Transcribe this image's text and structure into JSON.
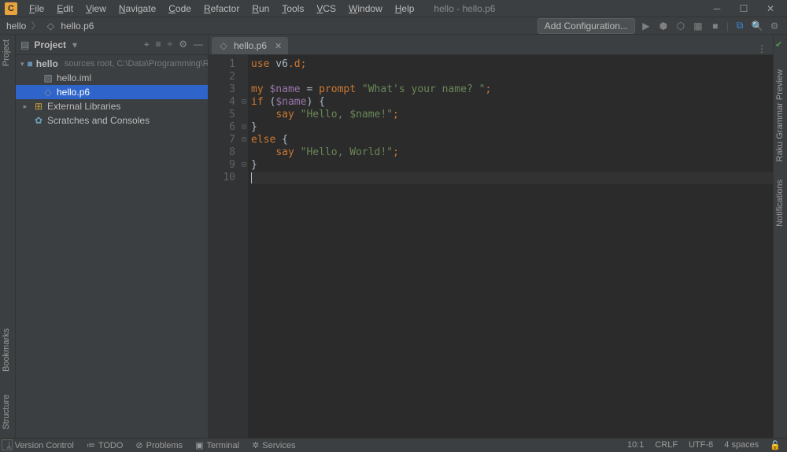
{
  "window": {
    "title": "hello - hello.p6"
  },
  "menu": [
    "File",
    "Edit",
    "View",
    "Navigate",
    "Code",
    "Refactor",
    "Run",
    "Tools",
    "VCS",
    "Window",
    "Help"
  ],
  "breadcrumbs": [
    "hello",
    "hello.p6"
  ],
  "toolbar": {
    "add_config": "Add Configuration..."
  },
  "left_tabs": {
    "project": "Project",
    "bookmarks": "Bookmarks",
    "structure": "Structure"
  },
  "sidebar": {
    "title": "Project",
    "root": {
      "name": "hello",
      "hint": "sources root,  C:\\Data\\Programming\\Raku\\hello"
    },
    "children": [
      {
        "name": "hello.iml",
        "type": "file"
      },
      {
        "name": "hello.p6",
        "type": "file",
        "selected": true
      }
    ],
    "ext_libs": "External Libraries",
    "scratches": "Scratches and Consoles"
  },
  "tabs": [
    {
      "label": "hello.p6"
    }
  ],
  "code": {
    "lines": [
      {
        "n": 1,
        "seg": [
          [
            "kw",
            "use"
          ],
          [
            "",
            " v6"
          ],
          [
            "pun",
            ".d"
          ],
          [
            "pun",
            ";"
          ]
        ]
      },
      {
        "n": 2,
        "seg": []
      },
      {
        "n": 3,
        "seg": [
          [
            "kw",
            "my"
          ],
          [
            "",
            " "
          ],
          [
            "var",
            "$name"
          ],
          [
            "",
            " = "
          ],
          [
            "kw",
            "prompt"
          ],
          [
            "",
            " "
          ],
          [
            "str",
            "\"What's your name? \""
          ],
          [
            "pun",
            ";"
          ]
        ]
      },
      {
        "n": 4,
        "fold": "-",
        "seg": [
          [
            "kw",
            "if"
          ],
          [
            "",
            " ("
          ],
          [
            "var",
            "$name"
          ],
          [
            "",
            ") {"
          ]
        ]
      },
      {
        "n": 5,
        "seg": [
          [
            "",
            "    "
          ],
          [
            "kw",
            "say"
          ],
          [
            "",
            " "
          ],
          [
            "str",
            "\"Hello, $name!\""
          ],
          [
            "pun",
            ";"
          ]
        ]
      },
      {
        "n": 6,
        "fold": "-",
        "seg": [
          [
            "",
            "}"
          ]
        ]
      },
      {
        "n": 7,
        "fold": "-",
        "seg": [
          [
            "kw",
            "else"
          ],
          [
            "",
            " {"
          ]
        ]
      },
      {
        "n": 8,
        "seg": [
          [
            "",
            "    "
          ],
          [
            "kw",
            "say"
          ],
          [
            "",
            " "
          ],
          [
            "str",
            "\"Hello, World!\""
          ],
          [
            "pun",
            ";"
          ]
        ]
      },
      {
        "n": 9,
        "fold": "-",
        "seg": [
          [
            "",
            "}"
          ]
        ]
      },
      {
        "n": 10,
        "cur": true,
        "seg": []
      }
    ]
  },
  "right_tabs": {
    "grammar": "Raku Grammar Preview",
    "notify": "Notifications"
  },
  "bottom": {
    "vc": "Version Control",
    "todo": "TODO",
    "problems": "Problems",
    "terminal": "Terminal",
    "services": "Services"
  },
  "status": {
    "pos": "10:1",
    "eol": "CRLF",
    "enc": "UTF-8",
    "indent": "4 spaces"
  }
}
